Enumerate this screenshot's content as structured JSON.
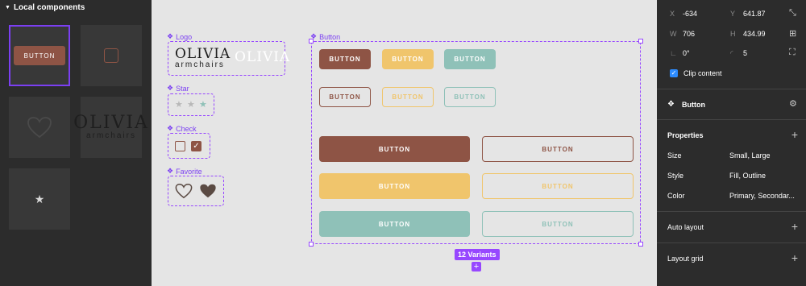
{
  "left_panel": {
    "title": "Local components",
    "thumbs": {
      "button_label": "BUTTON",
      "logo_big": "OLIVIA",
      "logo_small": "armchairs"
    }
  },
  "canvas": {
    "logo_label": "Logo",
    "logo_text": "OLIVIA",
    "logo_sub": "armchairs",
    "star_label": "Star",
    "check_label": "Check",
    "favorite_label": "Favorite",
    "button_label": "Button",
    "button_text": "BUTTON",
    "variants_label": "12 Variants"
  },
  "right_panel": {
    "x_label": "X",
    "x_value": "-634",
    "y_label": "Y",
    "y_value": "641.87",
    "w_label": "W",
    "w_value": "706",
    "h_label": "H",
    "h_value": "434.99",
    "rotation_value": "0°",
    "radius_value": "5",
    "clip_content": "Clip content",
    "component_name": "Button",
    "properties_title": "Properties",
    "properties": [
      {
        "name": "Size",
        "value": "Small, Large"
      },
      {
        "name": "Style",
        "value": "Fill, Outline"
      },
      {
        "name": "Color",
        "value": "Primary, Secondar..."
      }
    ],
    "auto_layout": "Auto layout",
    "layout_grid": "Layout grid"
  },
  "colors": {
    "brown": "#8e5445",
    "yellow": "#f0c56c",
    "teal": "#8fc1b8",
    "selection": "#9747ff"
  }
}
